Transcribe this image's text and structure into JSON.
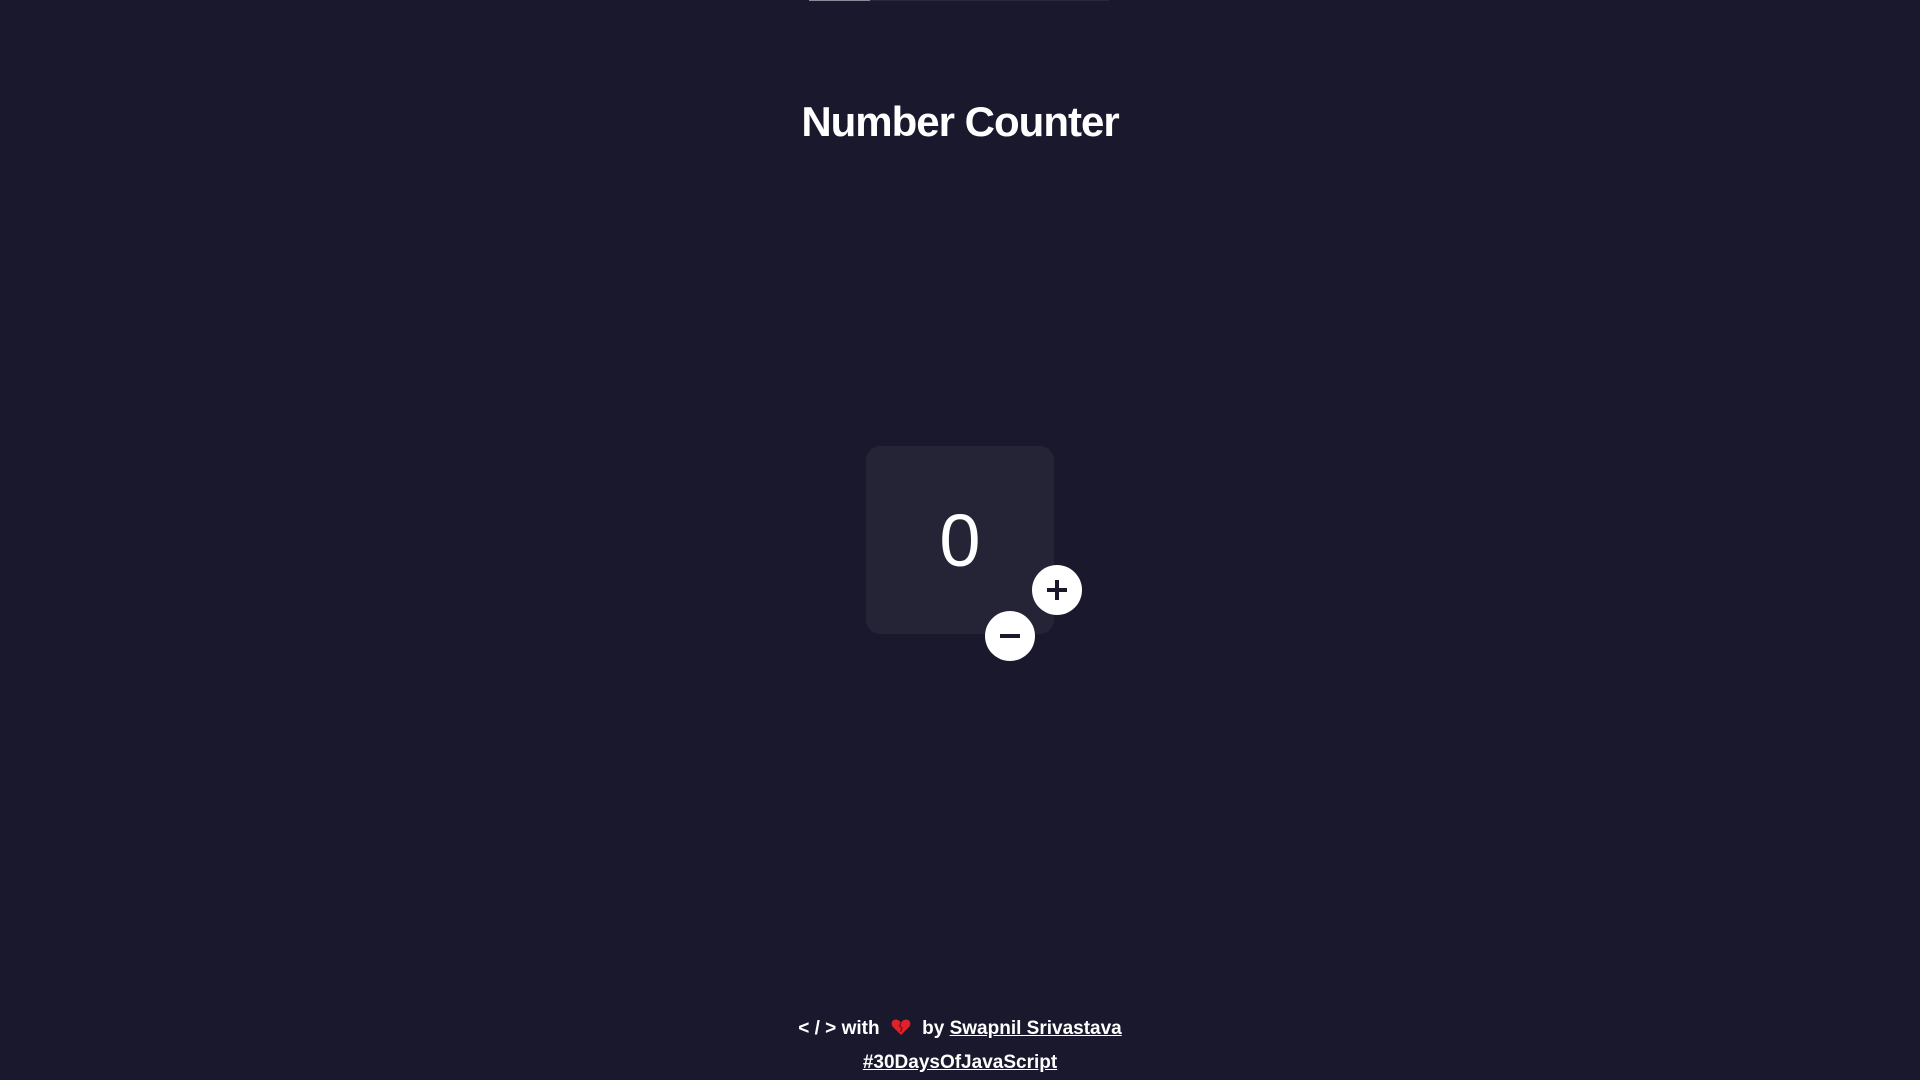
{
  "header": {
    "title": "Number Counter"
  },
  "counter": {
    "value": "0",
    "increment_icon": "plus-icon",
    "decrement_icon": "minus-icon"
  },
  "footer": {
    "code_glyph": "< / >",
    "with_text": "with",
    "heart_icon": "heart-icon",
    "by_text": "by",
    "author_link": "Swapnil Srivastava",
    "hashtag_link": "#30DaysOfJavaScript"
  },
  "colors": {
    "background": "#1a182c",
    "card": "#252336",
    "button": "#ffffff",
    "heart": "#e0202a"
  }
}
